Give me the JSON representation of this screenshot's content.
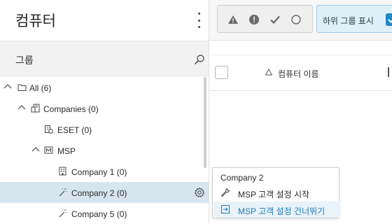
{
  "left_panel": {
    "title": "컴퓨터",
    "groups_label": "그룹",
    "tree": [
      {
        "label": "All (6)",
        "icon": "folder-icon",
        "expanded": true,
        "level": 0
      },
      {
        "label": "Companies (0)",
        "icon": "companies-icon",
        "expanded": true,
        "level": 1
      },
      {
        "label": "ESET (0)",
        "icon": "eset-company-icon",
        "expanded": false,
        "level": 2
      },
      {
        "label": "MSP",
        "icon": "msp-icon",
        "expanded": true,
        "level": 2
      },
      {
        "label": "Company 1 (0)",
        "icon": "building-icon",
        "expanded": false,
        "level": 3
      },
      {
        "label": "Company 2 (0)",
        "icon": "magic-wand-icon",
        "expanded": false,
        "level": 3,
        "selected": true
      },
      {
        "label": "Company 5 (0)",
        "icon": "magic-wand-icon",
        "expanded": false,
        "level": 3
      }
    ]
  },
  "right_panel": {
    "filters": [
      "warning-icon",
      "error-icon",
      "check-icon",
      "circle-icon"
    ],
    "subgroup_label": "하위 그룹 표시",
    "subgroup_checked": true,
    "column_name": "컴퓨터 이름"
  },
  "context_menu": {
    "title": "Company 2",
    "items": [
      {
        "label": "MSP 고객 설정 시작",
        "icon": "wrench-icon"
      },
      {
        "label": "MSP 고객 설정 건너뛰기",
        "icon": "skip-setup-icon",
        "hover": true
      }
    ]
  },
  "colors": {
    "selected_row": "#d7e6ee",
    "accent": "#1e88c8",
    "hover_text": "#1f7bb6"
  }
}
